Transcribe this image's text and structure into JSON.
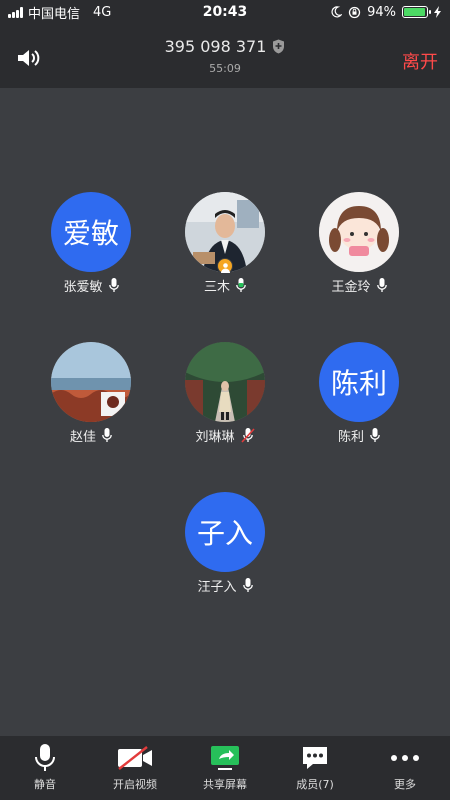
{
  "status_bar": {
    "carrier": "中国电信",
    "network": "4G",
    "time": "20:43",
    "battery": "94%",
    "battery_level": 0.94
  },
  "header": {
    "meeting_id": "395 098 371",
    "duration": "55:09",
    "leave_label": "离开",
    "leave_color": "#ff4a4a"
  },
  "participants": [
    {
      "name": "张爱敏",
      "initials": "爱敏"
    },
    {
      "name": "三木"
    },
    {
      "name": "王金玲"
    },
    {
      "name": "赵佳"
    },
    {
      "name": "刘琳琳"
    },
    {
      "name": "陈利",
      "initials": "陈利"
    },
    {
      "name": "汪子入",
      "initials": "子入"
    }
  ],
  "toolbar": {
    "mute_label": "静音",
    "video_label": "开启视频",
    "share_label": "共享屏幕",
    "members_label": "成员(7)",
    "more_label": "更多"
  },
  "colors": {
    "avatar_blue": "#2f6bf0",
    "share_green": "#27c05a",
    "video_off_red": "#e23b3b"
  }
}
